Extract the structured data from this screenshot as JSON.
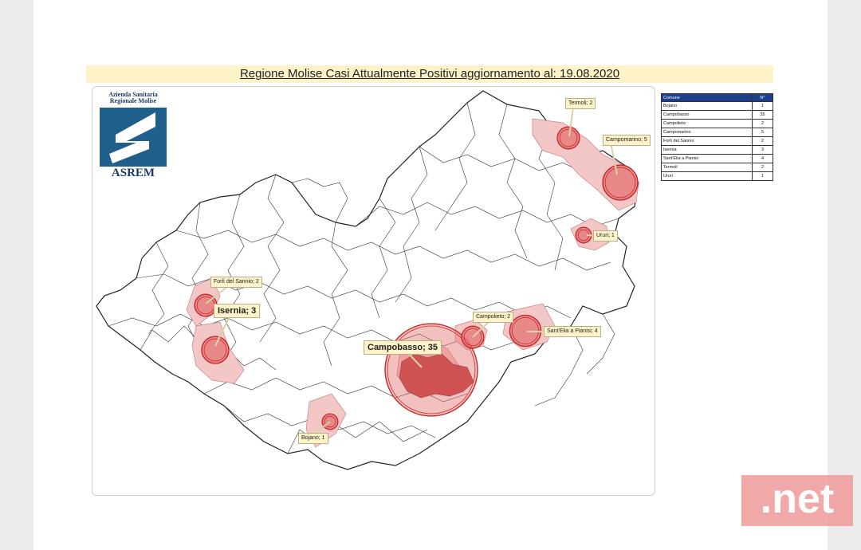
{
  "title": "Regione Molise Casi Attualmente Positivi aggiornamento al: 19.08.2020",
  "logo": {
    "line1": "Azienda Sanitaria",
    "line2": "Regionale Molise",
    "name": "ASREM"
  },
  "table": {
    "headers": [
      "Comune",
      "N°"
    ],
    "rows": [
      {
        "comune": "Bojano",
        "n": "1"
      },
      {
        "comune": "Campobasso",
        "n": "35"
      },
      {
        "comune": "Campolieto",
        "n": "2"
      },
      {
        "comune": "Campomarino",
        "n": "5"
      },
      {
        "comune": "Forlì del Sannio",
        "n": "2"
      },
      {
        "comune": "Isernia",
        "n": "3"
      },
      {
        "comune": "Sant'Elia a Pianisi",
        "n": "4"
      },
      {
        "comune": "Termoli",
        "n": "2"
      },
      {
        "comune": "Ururi",
        "n": "1"
      }
    ]
  },
  "callouts": {
    "termoli": "Termoli; 2",
    "campomarino": "Campomarino; 5",
    "ururi": "Ururi; 1",
    "forli": "Forlì del Sannio; 2",
    "isernia": "Isernia; 3",
    "campolieto": "Campolieto; 2",
    "santelia": "Sant'Elia a Pianisi; 4",
    "campobasso": "Campobasso; 35",
    "bojano": "Bojano; 1"
  },
  "badge": ".net",
  "colors": {
    "title_bg": "#fdf2c8",
    "table_header": "#1f3f8c",
    "bubble_fill": "#e57373",
    "bubble_stroke": "#c62828",
    "highlight_fill": "#f4c7c7",
    "campobasso_fill": "#c0393b"
  }
}
